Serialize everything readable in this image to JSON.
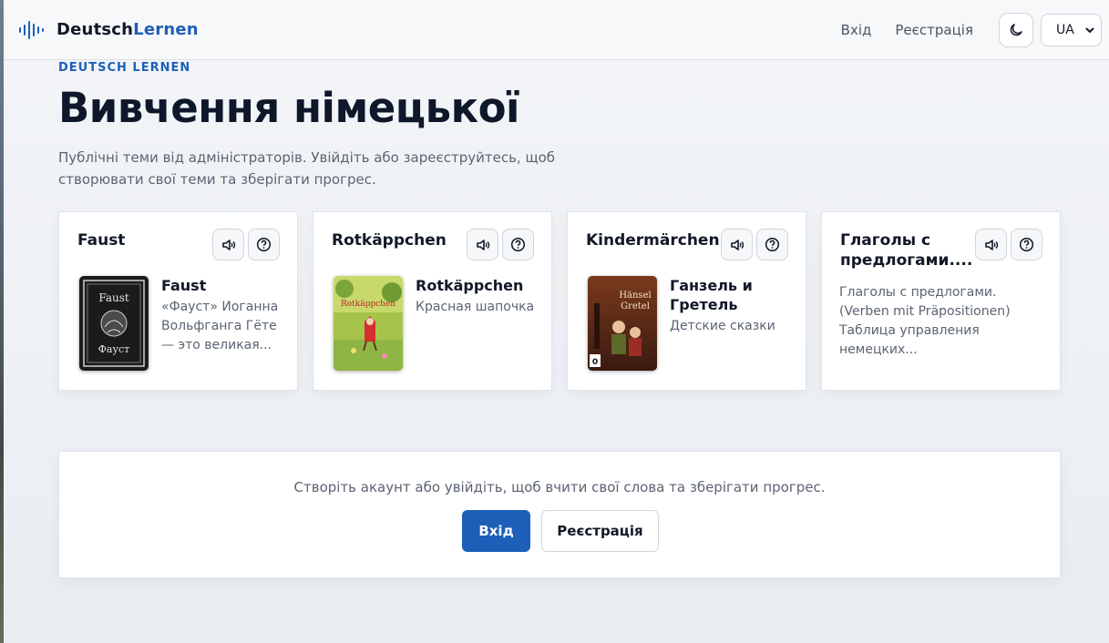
{
  "header": {
    "logo_part1": "Deutsch",
    "logo_part2": "Lernen",
    "login_label": "Вхід",
    "register_label": "Реєстрація",
    "theme_icon": "moon-icon",
    "language": "UA"
  },
  "hero": {
    "eyebrow": "DEUTSCH LERNEN",
    "title": "Вивчення німецької",
    "subtitle": "Публічні теми від адміністраторів. Увійдіть або зареєструйтесь, щоб створювати свої теми та зберігати прогрес."
  },
  "cards": [
    {
      "title": "Faust",
      "book_title": "Faust",
      "description": "«Фауст» Иоганна Вольфганга Гёте — это великая..."
    },
    {
      "title": "Rotkäppchen",
      "book_title": "Rotkäppchen",
      "description": "Красная шапочка"
    },
    {
      "title": "Kindermärchen",
      "book_title": "Ганзель и Гретель",
      "description": "Детские сказки"
    },
    {
      "title": "Глаголы с предлогами....",
      "description": "Глаголы с предлогами. (Verben mit Präpositionen) Таблица управления немецких..."
    }
  ],
  "cover_texts": {
    "faust_top": "Faust",
    "faust_bottom": "Фауст",
    "rotkappchen": "Rotkäppchen",
    "hansel_1": "Hänsel",
    "hansel_2": "Gretel",
    "hansel_rating": "0"
  },
  "cta": {
    "text": "Створіть акаунт або увійдіть, щоб вчити свої слова та зберігати прогрес.",
    "login_label": "Вхід",
    "register_label": "Реєстрація"
  },
  "colors": {
    "accent": "#1d5fb8",
    "text_dark": "#0f172a",
    "text_muted": "#5b6472"
  }
}
